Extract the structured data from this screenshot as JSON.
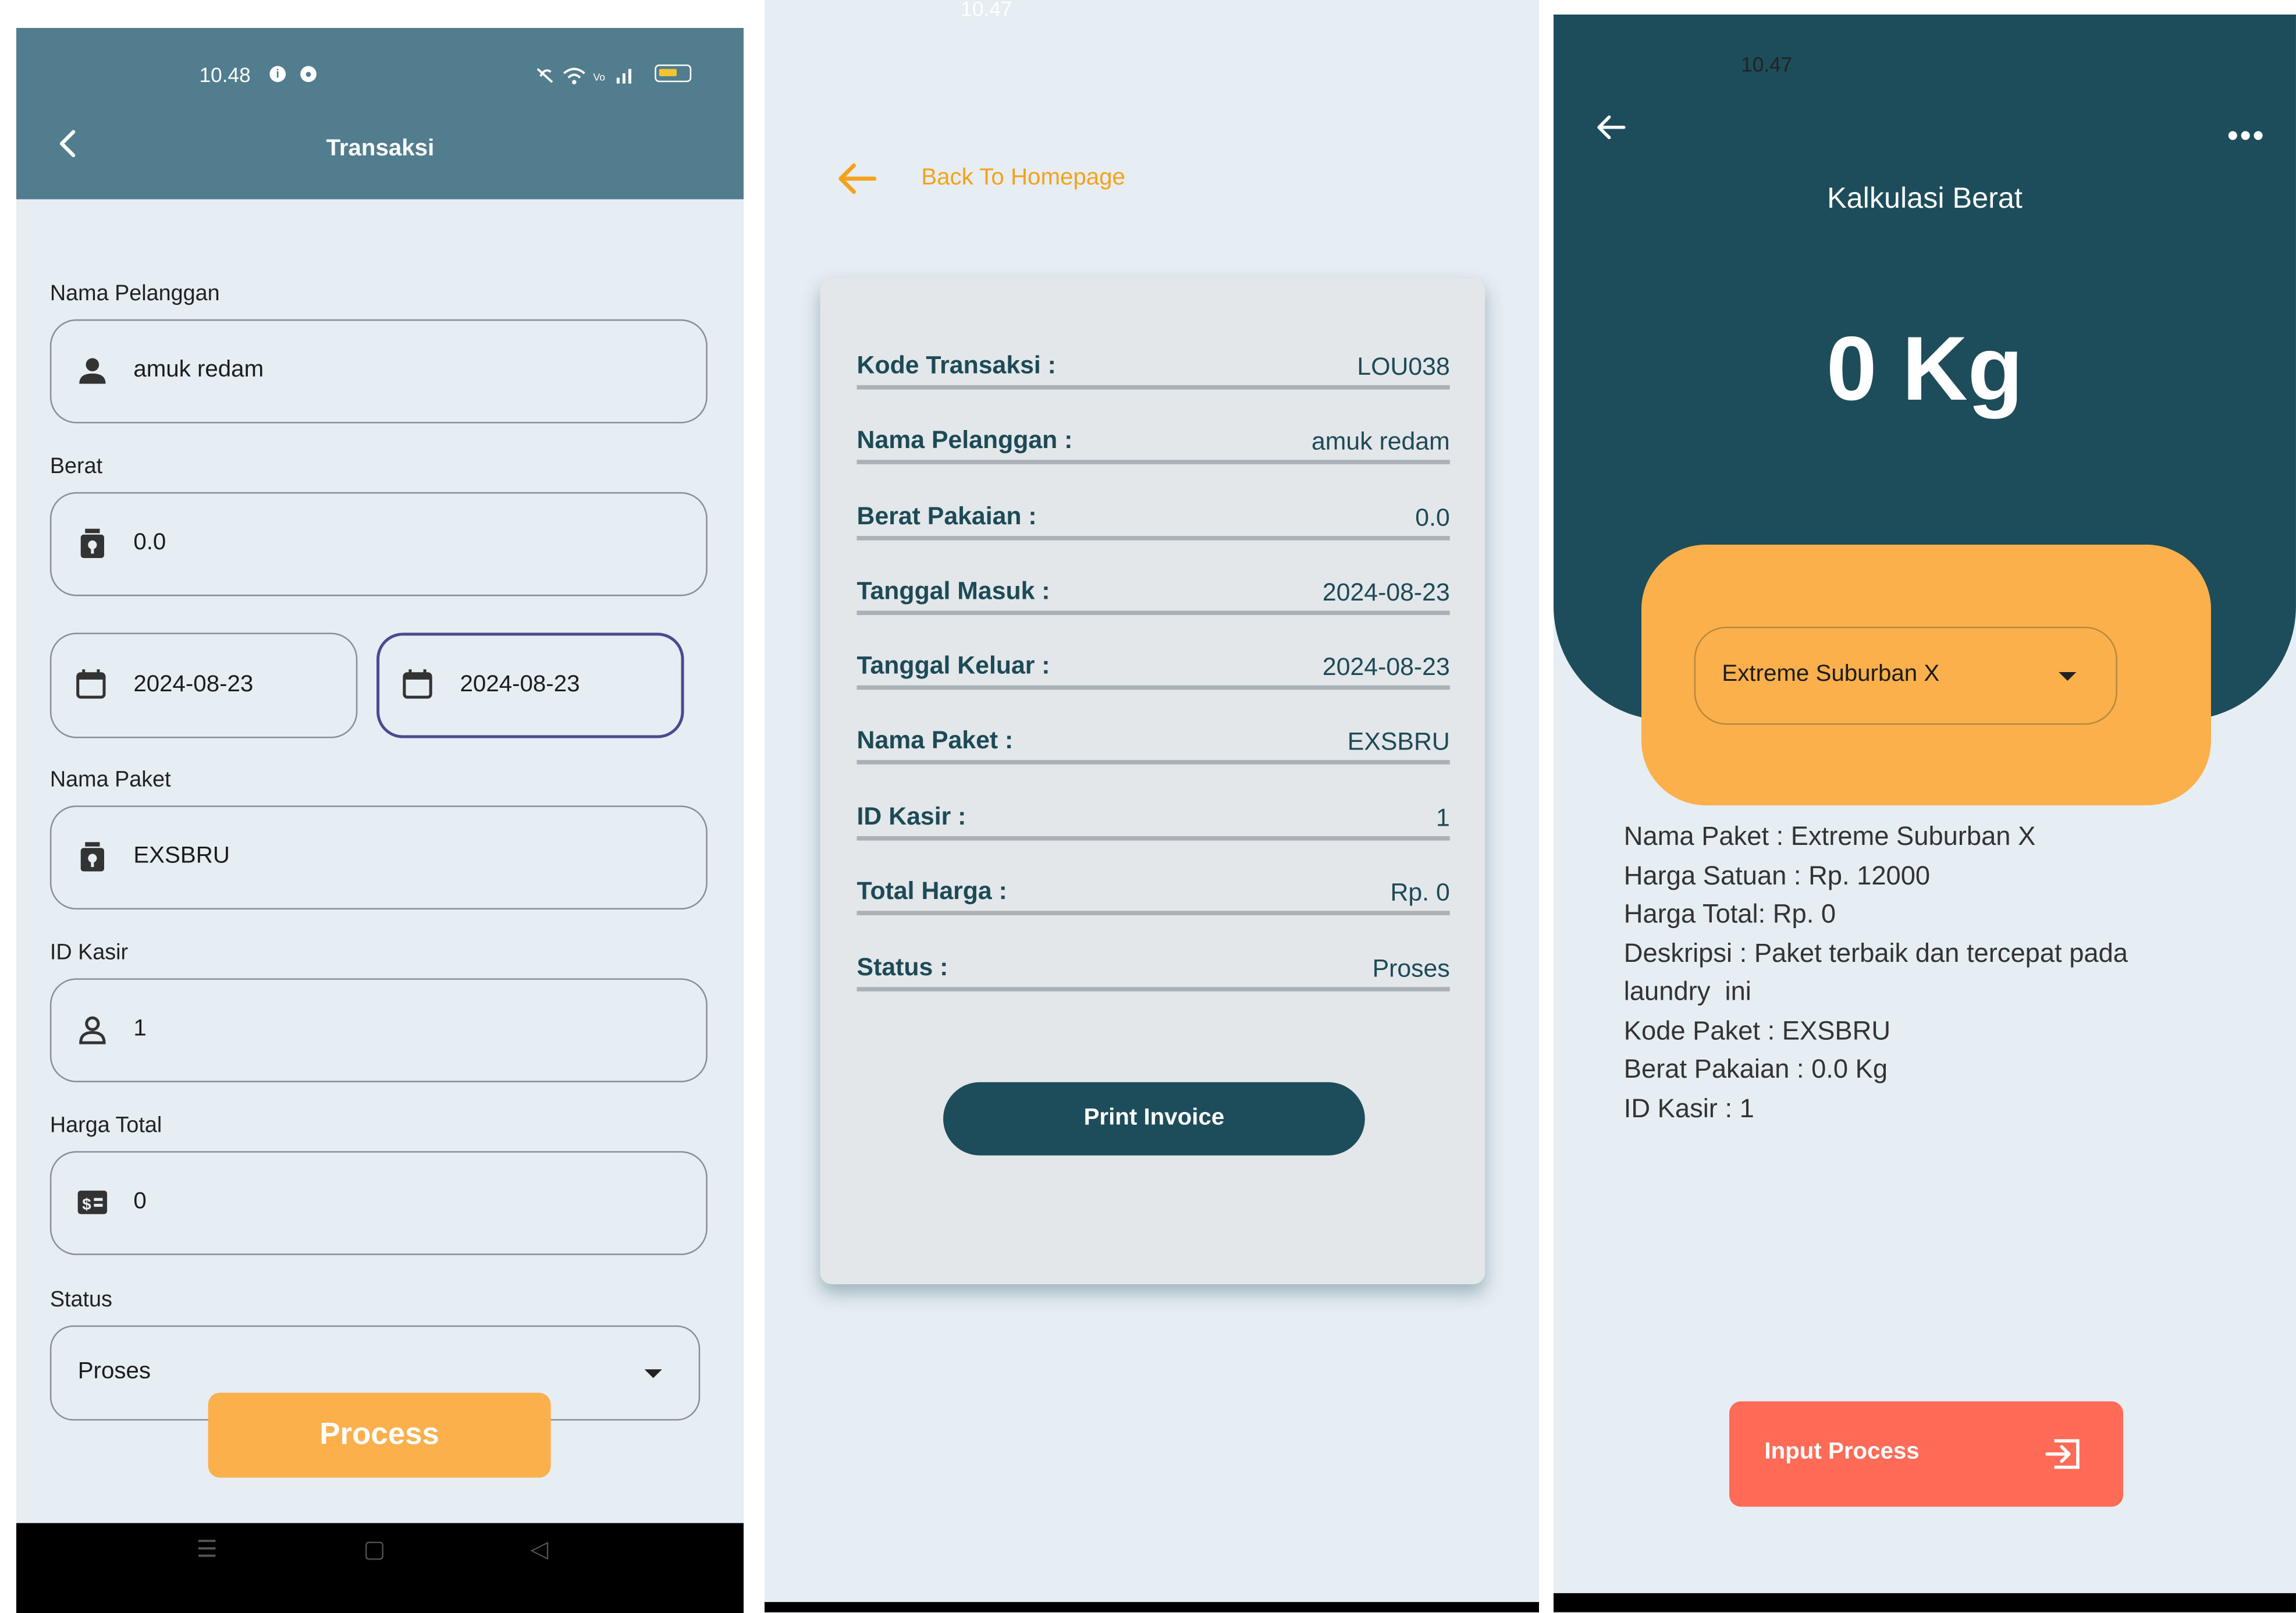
{
  "panel1": {
    "status_time": "10.48",
    "title": "Transaksi",
    "fields": {
      "nama_pelanggan": {
        "label": "Nama Pelanggan",
        "value": "amuk redam"
      },
      "berat": {
        "label": "Berat",
        "value": "0.0"
      },
      "tanggal_masuk": {
        "value": "2024-08-23"
      },
      "tanggal_keluar": {
        "value": "2024-08-23"
      },
      "nama_paket": {
        "label": "Nama Paket",
        "value": "EXSBRU"
      },
      "id_kasir": {
        "label": "ID Kasir",
        "value": "1"
      },
      "harga_total": {
        "label": "Harga Total",
        "value": "0"
      },
      "status": {
        "label": "Status",
        "value": "Proses"
      }
    },
    "process_label": "Process",
    "colors": {
      "header": "#517d8f",
      "accent": "#fbb04b",
      "active_border": "#4a4a8f"
    },
    "icons": [
      "back-arrow-icon",
      "person-icon",
      "weight-icon",
      "calendar-icon",
      "person-outline-icon",
      "money-icon",
      "dropdown-caret-icon"
    ]
  },
  "panel2": {
    "status_time": "10.47",
    "back_label": "Back To Homepage",
    "invoice": [
      {
        "key": "Kode Transaksi :",
        "value": "LOU038"
      },
      {
        "key": "Nama Pelanggan :",
        "value": "amuk redam"
      },
      {
        "key": "Berat Pakaian :",
        "value": "0.0"
      },
      {
        "key": "Tanggal Masuk :",
        "value": "2024-08-23"
      },
      {
        "key": "Tanggal Keluar :",
        "value": "2024-08-23"
      },
      {
        "key": "Nama Paket :",
        "value": "EXSBRU"
      },
      {
        "key": "ID Kasir :",
        "value": "1"
      },
      {
        "key": "Total Harga :",
        "value": "Rp. 0"
      },
      {
        "key": "Status :",
        "value": "Proses"
      }
    ],
    "print_label": "Print Invoice",
    "colors": {
      "back": "#f4a21b",
      "text": "#1d4a57",
      "button": "#1d4c5b"
    }
  },
  "panel3": {
    "status_time": "10.47",
    "title": "Kalkulasi Berat",
    "weight": "0 Kg",
    "selected_package": "Extreme Suburban X",
    "details": [
      "Nama Paket : Extreme Suburban X",
      "Harga Satuan : Rp. 12000",
      "Harga Total: Rp. 0",
      "Deskripsi : Paket terbaik dan tercepat pada",
      "laundry  ini",
      "Kode Paket : EXSBRU",
      "Berat Pakaian : 0.0 Kg",
      "ID Kasir : 1"
    ],
    "input_label": "Input Process",
    "colors": {
      "header": "#1d4c5b",
      "card": "#fbb04b",
      "button": "#ff6b57"
    },
    "icons": [
      "back-arrow-icon",
      "more-icon",
      "dropdown-caret-icon",
      "input-icon"
    ]
  }
}
